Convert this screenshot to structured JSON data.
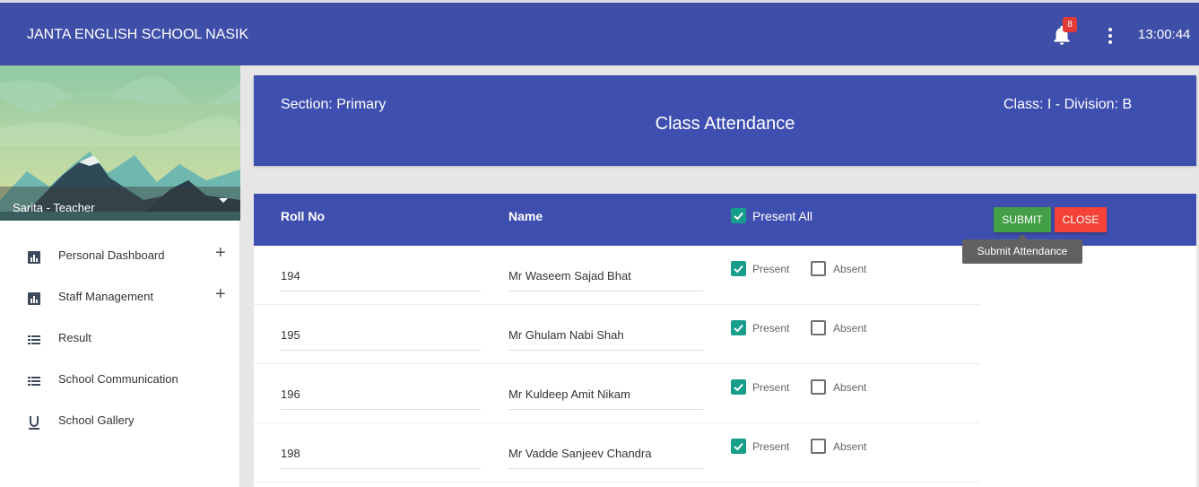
{
  "app": {
    "title": "JANTA ENGLISH SCHOOL NASIK",
    "notification_count": "8",
    "time": "13:00:44"
  },
  "sidebar": {
    "user": "Sarita - Teacher",
    "items": [
      {
        "label": "Personal Dashboard",
        "icon": "bar-chart-icon",
        "expandable": true
      },
      {
        "label": "Staff Management",
        "icon": "bar-chart-icon",
        "expandable": true
      },
      {
        "label": "Result",
        "icon": "list-icon",
        "expandable": false
      },
      {
        "label": "School Communication",
        "icon": "list-icon",
        "expandable": false
      },
      {
        "label": "School Gallery",
        "icon": "underline-icon",
        "expandable": false
      }
    ]
  },
  "header": {
    "section": "Section: Primary",
    "title": "Class Attendance",
    "class_division": "Class: I - Division: B"
  },
  "table": {
    "columns": {
      "roll": "Roll No",
      "name": "Name",
      "present_all": "Present All"
    },
    "present_all_checked": true,
    "submit_label": "SUBMIT",
    "close_label": "CLOSE",
    "submit_tooltip": "Submit Attendance",
    "present_label": "Present",
    "absent_label": "Absent",
    "rows": [
      {
        "roll": "194",
        "name": "Mr Waseem Sajad Bhat",
        "present": true
      },
      {
        "roll": "195",
        "name": "Mr Ghulam Nabi Shah",
        "present": true
      },
      {
        "roll": "196",
        "name": "Mr Kuldeep Amit Nikam",
        "present": true
      },
      {
        "roll": "198",
        "name": "Mr Vadde Sanjeev Chandra",
        "present": true
      }
    ]
  },
  "colors": {
    "primary": "#3f4fb0",
    "submit": "#43a047",
    "close": "#f44336",
    "check": "#169e8a"
  }
}
